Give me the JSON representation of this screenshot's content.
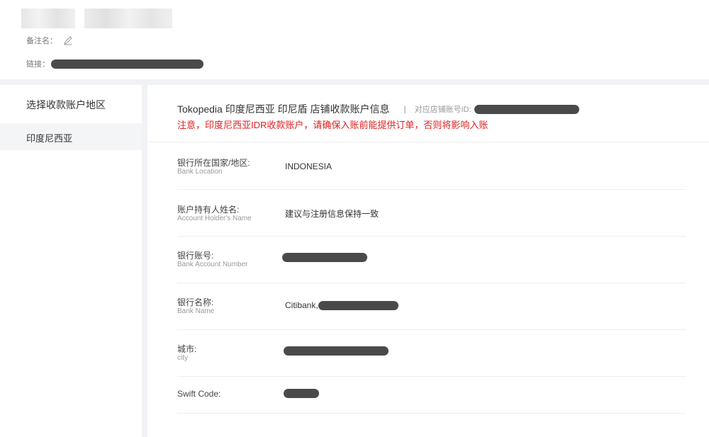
{
  "top": {
    "remark_label": "备注名：",
    "link_label": "链接："
  },
  "sidebar": {
    "title": "选择收款账户地区",
    "items": [
      {
        "label": "印度尼西亚"
      }
    ]
  },
  "main": {
    "header_title": "Tokopedia 印度尼西亚 印尼盾 店铺收款账户信息",
    "separator": "|",
    "store_id_label": "对应店铺账号ID:",
    "warning": "注意，印度尼西亚IDR收款账户，请确保入账前能提供订单，否则将影响入账"
  },
  "fields": {
    "bank_location": {
      "label": "银行所在国家/地区:",
      "sub": "Bank Location",
      "value": "INDONESIA"
    },
    "holder_name": {
      "label": "账户持有人姓名:",
      "sub": "Account Holder's Name",
      "value": "建议与注册信息保持一致"
    },
    "account_number": {
      "label": "银行账号:",
      "sub": "Bank Account Number",
      "value": ""
    },
    "bank_name": {
      "label": "银行名称:",
      "sub": "Bank Name",
      "value": "Citibank,"
    },
    "city": {
      "label": "城市:",
      "sub": "city",
      "value": ""
    },
    "swift": {
      "label": "Swift Code:",
      "value": ""
    }
  },
  "colors": {
    "warning": "#e02020",
    "redaction": "#4a4a4a",
    "divider": "#f0f2f5",
    "selected_item_bg": "#f4f5f7"
  },
  "icons": {
    "edit": "pencil-icon"
  }
}
